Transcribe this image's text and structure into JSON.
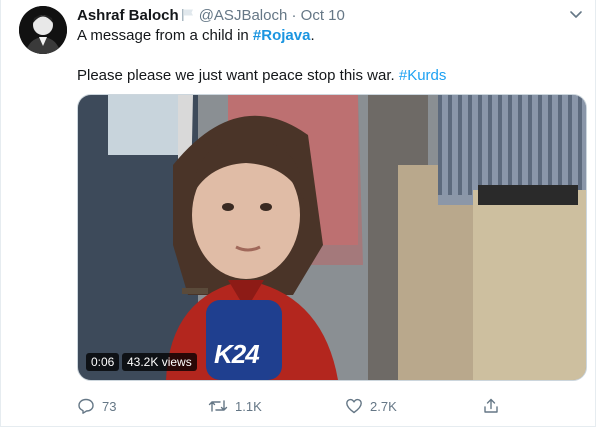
{
  "tweet": {
    "author_name": "Ashraf Baloch",
    "handle": "@ASJBaloch",
    "separator": "·",
    "date": "Oct 10",
    "text_line1_prefix": "A message from a child in ",
    "text_line1_hashtag": "#Rojava",
    "text_line1_suffix": ".",
    "text_line2_prefix": "Please please we just want peace stop this war. ",
    "text_line2_hashtag": "#Kurds"
  },
  "video": {
    "duration": "0:06",
    "views": "43.2K views",
    "microphone_logo_text": "K24"
  },
  "actions": {
    "replies": "73",
    "retweets": "1.1K",
    "likes": "2.7K"
  },
  "icons": [
    "flag-icon",
    "chevron-down-icon",
    "reply-icon",
    "retweet-icon",
    "like-icon",
    "share-icon"
  ],
  "colors": {
    "link": "#1da1f2",
    "secondary_text": "#657786",
    "text": "#14171a",
    "border": "#e6ecf0"
  }
}
